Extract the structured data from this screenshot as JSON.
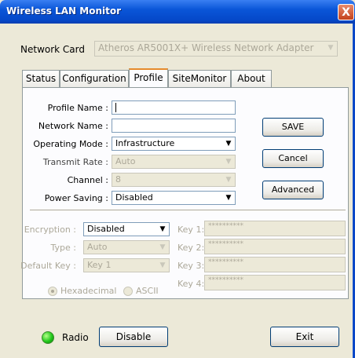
{
  "window": {
    "title": "Wireless LAN Monitor",
    "close_glyph": "X"
  },
  "network_card": {
    "label": "Network Card",
    "value": "Atheros AR5001X+ Wireless Network Adapter"
  },
  "tabs": [
    {
      "label": "Status"
    },
    {
      "label": "Configuration"
    },
    {
      "label": "Profile"
    },
    {
      "label": "SiteMonitor"
    },
    {
      "label": "About"
    }
  ],
  "active_tab": "Profile",
  "profile": {
    "profile_name_label": "Profile Name :",
    "profile_name_value": "",
    "network_name_label": "Network Name :",
    "network_name_value": "",
    "operating_mode_label": "Operating Mode :",
    "operating_mode_value": "Infrastructure",
    "transmit_rate_label": "Transmit Rate :",
    "transmit_rate_value": "Auto",
    "channel_label": "Channel :",
    "channel_value": "8",
    "power_saving_label": "Power Saving :",
    "power_saving_value": "Disabled",
    "save_label": "SAVE",
    "cancel_label": "Cancel",
    "advanced_label": "Advanced"
  },
  "security": {
    "encryption_label": "Encryption :",
    "encryption_value": "Disabled",
    "type_label": "Type :",
    "type_value": "Auto",
    "default_key_label": "Default Key :",
    "default_key_value": "Key 1",
    "keys": [
      {
        "label": "Key 1:",
        "value": "**********"
      },
      {
        "label": "Key 2:",
        "value": "**********"
      },
      {
        "label": "Key 3:",
        "value": "**********"
      },
      {
        "label": "Key 4:",
        "value": "**********"
      }
    ],
    "hex_label": "Hexadecimal",
    "ascii_label": "ASCII"
  },
  "footer": {
    "radio_label": "Radio",
    "disable_label": "Disable",
    "exit_label": "Exit"
  },
  "colors": {
    "title_bar": "#0a56d8",
    "led": "#22c81c"
  }
}
